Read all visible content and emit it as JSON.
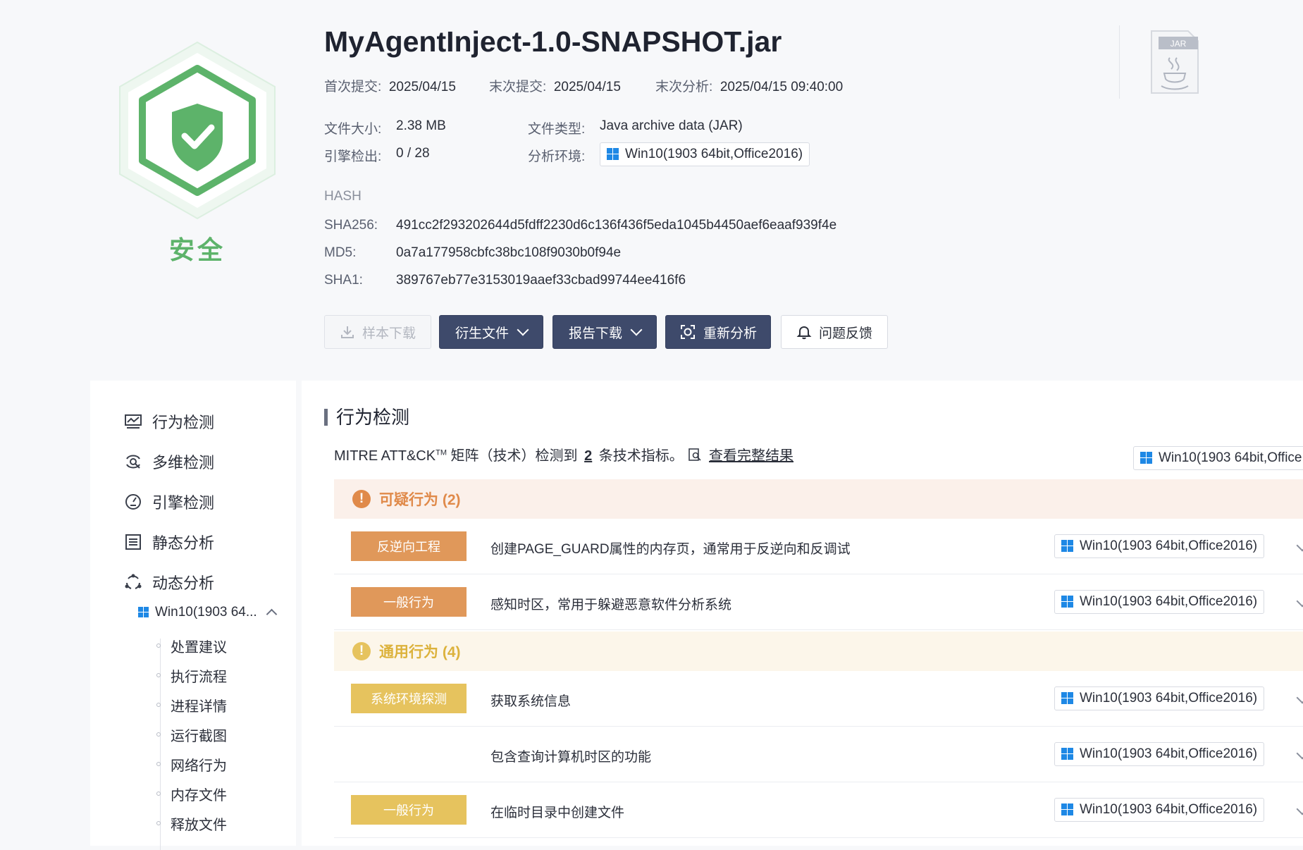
{
  "verdict": "安全",
  "file": {
    "name": "MyAgentInject-1.0-SNAPSHOT.jar",
    "first_submit_label": "首次提交:",
    "first_submit": "2025/04/15",
    "last_submit_label": "末次提交:",
    "last_submit": "2025/04/15",
    "last_analysis_label": "末次分析:",
    "last_analysis": "2025/04/15 09:40:00",
    "size_label": "文件大小:",
    "size": "2.38 MB",
    "type_label": "文件类型:",
    "type": "Java archive data (JAR)",
    "engine_label": "引擎检出:",
    "engine": "0 / 28",
    "env_label": "分析环境:",
    "env": "Win10(1903 64bit,Office2016)",
    "icon_text": "JAR"
  },
  "hash": {
    "title": "HASH",
    "sha256_label": "SHA256:",
    "sha256": "491cc2f293202644d5fdff2230d6c136f436f5eda1045b4450aef6eaaf939f4e",
    "md5_label": "MD5:",
    "md5": "0a7a177958cbfc38bc108f9030b0f94e",
    "sha1_label": "SHA1:",
    "sha1": "389767eb77e3153019aaef33cbad99744ee416f6"
  },
  "actions": {
    "download": "样本下载",
    "derived": "衍生文件",
    "report": "报告下载",
    "reanalyze": "重新分析",
    "feedback": "问题反馈"
  },
  "sidebar": {
    "items": [
      "行为检测",
      "多维检测",
      "引擎检测",
      "静态分析",
      "动态分析"
    ],
    "env_short": "Win10(1903 64...",
    "subitems": [
      "处置建议",
      "执行流程",
      "进程详情",
      "运行截图",
      "网络行为",
      "内存文件",
      "释放文件"
    ]
  },
  "main": {
    "title": "行为检测",
    "mitre_prefix": "MITRE ATT&CK",
    "mitre_tm": "TM",
    "mitre_mid": " 矩阵（技术）检测到 ",
    "mitre_count": "2",
    "mitre_suffix": " 条技术指标。",
    "full_result": "查看完整结果",
    "top_env": "Win10(1903 64bit,Office",
    "suspicious_title": "可疑行为 (2)",
    "general_title": "通用行为 (4)",
    "rows": [
      {
        "tag": "反逆向工程",
        "desc": "创建PAGE_GUARD属性的内存页，通常用于反逆向和反调试",
        "env": "Win10(1903 64bit,Office2016)"
      },
      {
        "tag": "一般行为",
        "desc": "感知时区，常用于躲避恶意软件分析系统",
        "env": "Win10(1903 64bit,Office2016)"
      },
      {
        "tag": "系统环境探测",
        "desc": "获取系统信息",
        "env": "Win10(1903 64bit,Office2016)"
      },
      {
        "tag": "",
        "desc": "包含查询计算机时区的功能",
        "env": "Win10(1903 64bit,Office2016)"
      },
      {
        "tag": "一般行为",
        "desc": "在临时目录中创建文件",
        "env": "Win10(1903 64bit,Office2016)"
      }
    ]
  },
  "colors": {
    "safe": "#5db36a",
    "suspicious_tag": "#e0985a",
    "suspicious_head_bg": "#fbf0ea",
    "suspicious_head_text": "#e08a4a",
    "general_tag": "#e6c35e",
    "general_head_bg": "#fcf6ea",
    "general_head_text": "#dcb23c",
    "button_dark": "#3e4a6b"
  }
}
